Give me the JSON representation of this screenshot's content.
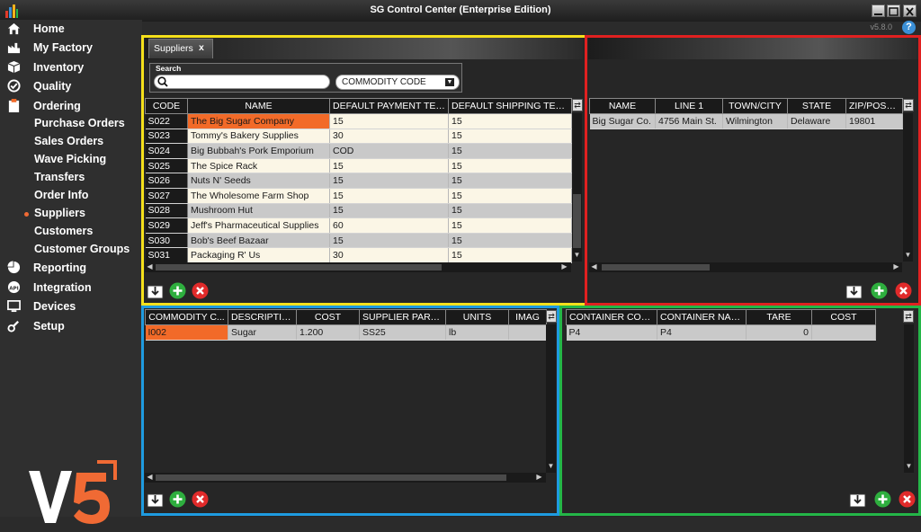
{
  "window": {
    "title": "SG Control Center (Enterprise Edition)",
    "version": "v5.8.0",
    "help": "?"
  },
  "sidebar": {
    "items": [
      {
        "label": "Home",
        "icon": "home-icon"
      },
      {
        "label": "My Factory",
        "icon": "factory-icon"
      },
      {
        "label": "Inventory",
        "icon": "inventory-box-icon"
      },
      {
        "label": "Quality",
        "icon": "check-circle-icon"
      },
      {
        "label": "Ordering",
        "icon": "clipboard-icon"
      },
      {
        "label": "Reporting",
        "icon": "pie-chart-icon"
      },
      {
        "label": "Integration",
        "icon": "api-icon"
      },
      {
        "label": "Devices",
        "icon": "monitor-icon"
      },
      {
        "label": "Setup",
        "icon": "wrench-icon"
      }
    ],
    "ordering_subitems": [
      "Purchase Orders",
      "Sales Orders",
      "Wave Picking",
      "Transfers",
      "Order Info",
      "Suppliers",
      "Customers",
      "Customer Groups"
    ],
    "active_subitem": "Suppliers",
    "logo_text": "V5"
  },
  "tab": {
    "label": "Suppliers",
    "close": "x"
  },
  "search": {
    "legend": "Search",
    "value": "",
    "placeholder": "",
    "filter_value": "COMMODITY CODE"
  },
  "suppliers": {
    "columns": [
      "CODE",
      "NAME",
      "DEFAULT PAYMENT TERMS",
      "DEFAULT SHIPPING TERMS"
    ],
    "rows": [
      [
        "S022",
        "The Big Sugar Company",
        "15",
        "15"
      ],
      [
        "S023",
        "Tommy's Bakery Supplies",
        "30",
        "15"
      ],
      [
        "S024",
        "Big Bubbah's Pork Emporium",
        "COD",
        "15"
      ],
      [
        "S025",
        "The Spice Rack",
        "15",
        "15"
      ],
      [
        "S026",
        "Nuts N' Seeds",
        "15",
        "15"
      ],
      [
        "S027",
        "The Wholesome Farm Shop",
        "15",
        "15"
      ],
      [
        "S028",
        "Mushroom Hut",
        "15",
        "15"
      ],
      [
        "S029",
        "Jeff's Pharmaceutical Supplies",
        "60",
        "15"
      ],
      [
        "S030",
        "Bob's Beef Bazaar",
        "15",
        "15"
      ],
      [
        "S031",
        "Packaging R' Us",
        "30",
        "15"
      ]
    ]
  },
  "addresses": {
    "columns": [
      "NAME",
      "LINE 1",
      "TOWN/CITY",
      "STATE",
      "ZIP/POSTAL"
    ],
    "rows": [
      [
        "Big Sugar Co.",
        "4756 Main St.",
        "Wilmington",
        "Delaware",
        "19801"
      ]
    ]
  },
  "commodities": {
    "columns": [
      "COMMODITY C...",
      "DESCRIPTION",
      "COST",
      "SUPPLIER PART ...",
      "UNITS",
      "IMAG"
    ],
    "rows": [
      [
        "I002",
        "Sugar",
        "1.200",
        "SS25",
        "lb",
        ""
      ]
    ]
  },
  "containers": {
    "columns": [
      "CONTAINER CODE",
      "CONTAINER NAME",
      "TARE",
      "COST"
    ],
    "rows": [
      [
        "P4",
        "P4",
        "0",
        ""
      ]
    ]
  },
  "colors": {
    "accent": "#f26a28",
    "yellow": "#f5e01b",
    "red": "#e02020",
    "blue": "#1e9be0",
    "green": "#24b648"
  }
}
